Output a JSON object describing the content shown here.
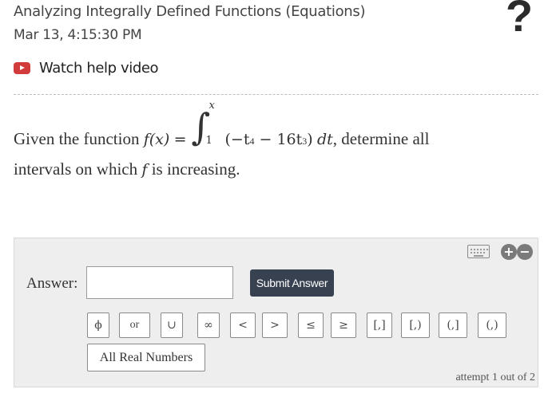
{
  "header": {
    "title": "Analyzing Integrally Defined Functions (Equations)",
    "timestamp": "Mar 13, 4:15:30 PM",
    "help_glyph": "?"
  },
  "help_video": {
    "label": "Watch help video"
  },
  "question": {
    "intro": "Given the function",
    "fname": "f",
    "arg": "(x)",
    "equals": "=",
    "integral_sign": "∫",
    "upper_limit": "x",
    "lower_limit": "1",
    "integrand_open": "(−t",
    "exp1": "4",
    "integrand_mid": " − 16t",
    "exp2": "3",
    "integrand_close": ")",
    "differential": "dt",
    "tail": ", determine all",
    "line2_start": "intervals on which",
    "line2_var": "f",
    "line2_end": "is increasing."
  },
  "answer": {
    "label": "Answer:",
    "value": "",
    "placeholder": "",
    "submit_label": "Submit Answer",
    "symbols": [
      "ϕ",
      "or",
      "∪",
      "∞",
      "<",
      ">",
      "≤",
      "≥",
      "[,]",
      "[,)",
      "(,]",
      "(,)"
    ],
    "all_real_label": "All Real Numbers",
    "attempt_text": "attempt 1 out of 2",
    "plus_glyph": "+",
    "minus_glyph": "−"
  }
}
